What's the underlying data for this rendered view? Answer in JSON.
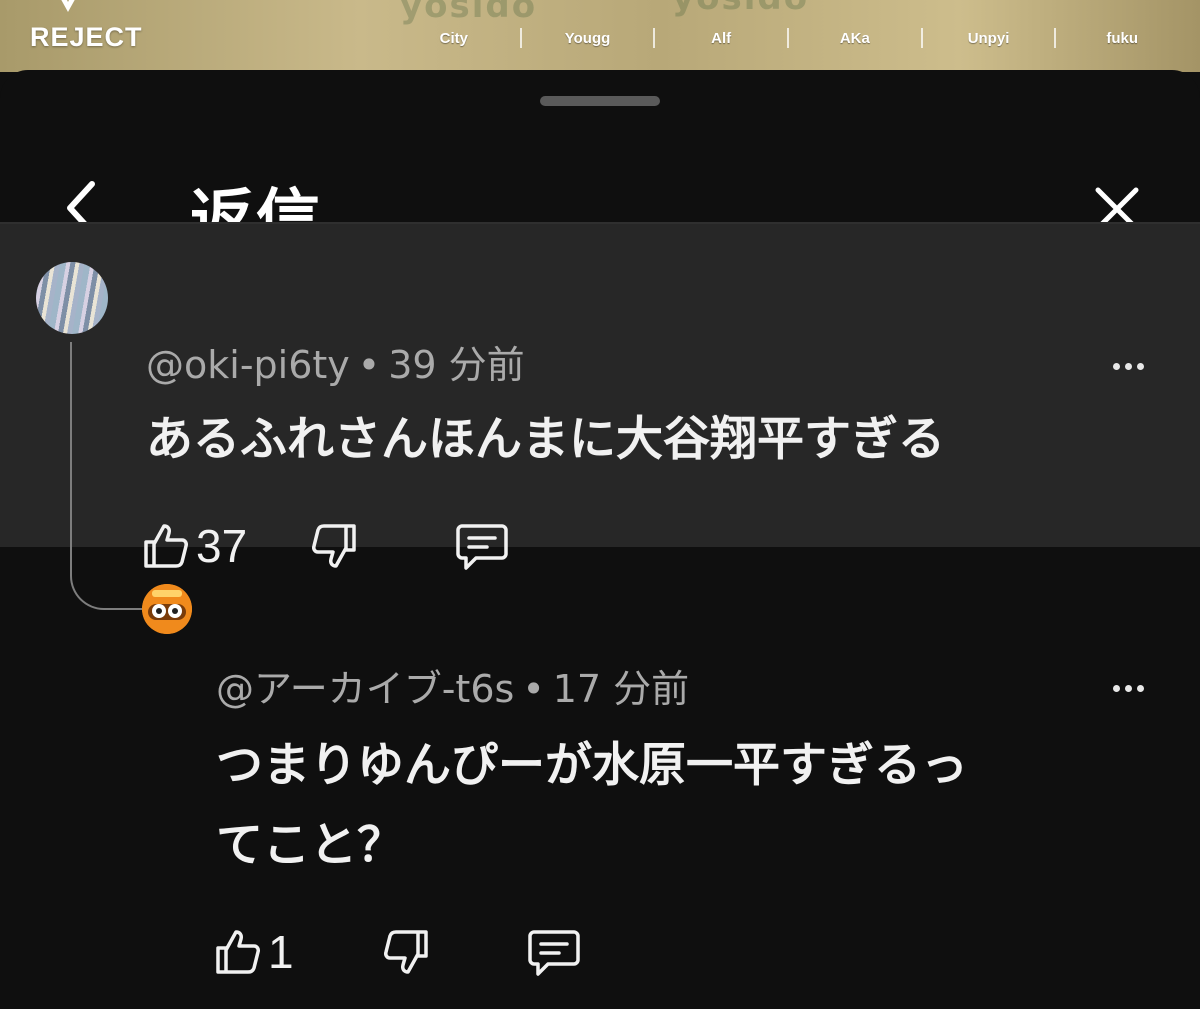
{
  "banner": {
    "logo": "REJECT",
    "watermark": "yosido",
    "names": [
      "City",
      "Yougg",
      "Alf",
      "AKa",
      "Unpyi",
      "fuku"
    ]
  },
  "header": {
    "title": "返信",
    "back_icon": "chevron-left-icon",
    "close_icon": "close-icon"
  },
  "comments": [
    {
      "handle": "@oki-pi6ty",
      "time": "39 分前",
      "separator": "•",
      "text": "あるふれさんほんまに大谷翔平すぎる",
      "likes": "37"
    },
    {
      "handle": "@アーカイブ-t6s",
      "time": "17 分前",
      "separator": "•",
      "text_line1": "つまりゆんぴーが水原一平すぎるっ",
      "text_line2": "てこと？",
      "likes": "1"
    }
  ],
  "colors": {
    "background": "#0f0f0f",
    "highlight": "#272727",
    "text": "#f1f1f1",
    "meta": "#aaaaaa"
  }
}
